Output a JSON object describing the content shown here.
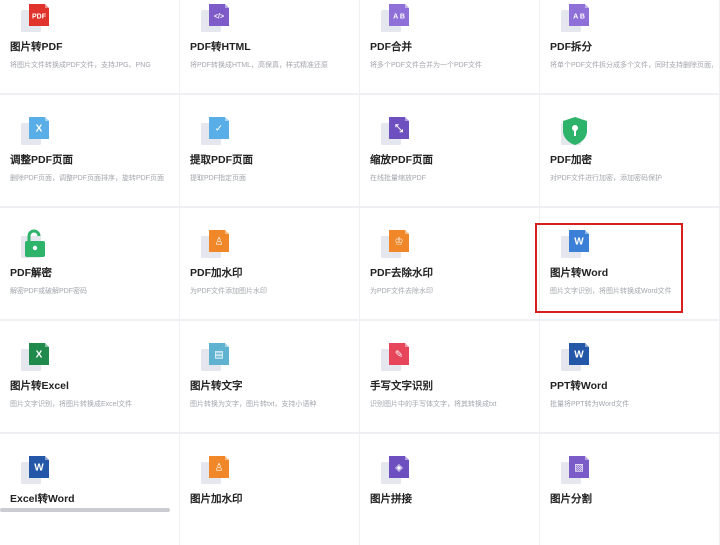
{
  "tools": [
    {
      "title": "图片转PDF",
      "desc": "将图片文件转换成PDF文件，支持JPG、PNG",
      "icon": "image-to-pdf-icon",
      "tag": "PDF",
      "color": "#e0332b"
    },
    {
      "title": "PDF转HTML",
      "desc": "将PDF转换成HTML，高保真，样式精准还原",
      "icon": "pdf-to-html-icon",
      "tag": "</>",
      "color": "#7d5cc9"
    },
    {
      "title": "PDF合并",
      "desc": "将多个PDF文件合并为一个PDF文件",
      "icon": "pdf-merge-icon",
      "tag": "A B",
      "color": "#8e70d8"
    },
    {
      "title": "PDF拆分",
      "desc": "将单个PDF文件拆分成多个文件，同时支持删除页面，对页面进行排序",
      "icon": "pdf-split-icon",
      "tag": "A B",
      "color": "#8e70d8"
    },
    {
      "title": "调整PDF页面",
      "desc": "删除PDF页面，调整PDF页面排序，旋转PDF页面",
      "icon": "adjust-pdf-pages-icon",
      "tag": "X",
      "color": "#5aaee8"
    },
    {
      "title": "提取PDF页面",
      "desc": "提取PDF指定页面",
      "icon": "extract-pdf-pages-icon",
      "tag": "✓",
      "color": "#5aaee8"
    },
    {
      "title": "缩放PDF页面",
      "desc": "在线批量缩放PDF",
      "icon": "scale-pdf-pages-icon",
      "tag": "⤡",
      "color": "#6e4fc0"
    },
    {
      "title": "PDF加密",
      "desc": "对PDF文件进行加密，添加密码保护",
      "icon": "pdf-encrypt-icon",
      "tag": "",
      "color": "#2eb36b"
    },
    {
      "title": "PDF解密",
      "desc": "解密PDF或破解PDF密码",
      "icon": "pdf-decrypt-icon",
      "tag": "",
      "color": "#2eb36b"
    },
    {
      "title": "PDF加水印",
      "desc": "为PDF文件添加图片水印",
      "icon": "pdf-add-watermark-icon",
      "tag": "♙",
      "color": "#f0882a"
    },
    {
      "title": "PDF去除水印",
      "desc": "为PDF文件去除水印",
      "icon": "pdf-remove-watermark-icon",
      "tag": "♔",
      "color": "#f0882a"
    },
    {
      "title": "图片转Word",
      "desc": "图片文字识别，将图片转换成Word文件",
      "icon": "image-to-word-icon",
      "tag": "W",
      "color": "#3c7fd6"
    },
    {
      "title": "图片转Excel",
      "desc": "图片文字识别，将图片转换成Excel文件",
      "icon": "image-to-excel-icon",
      "tag": "X",
      "color": "#1f8a4c"
    },
    {
      "title": "图片转文字",
      "desc": "图片转换为文字，图片转txt，支持小语种",
      "icon": "image-to-text-icon",
      "tag": "▤",
      "color": "#5fb3d1"
    },
    {
      "title": "手写文字识别",
      "desc": "识别图片中的手写体文字，将其转换成txt",
      "icon": "handwriting-recognition-icon",
      "tag": "✎",
      "color": "#e6455a"
    },
    {
      "title": "PPT转Word",
      "desc": "批量将PPT转为Word文件",
      "icon": "ppt-to-word-icon",
      "tag": "W",
      "color": "#2457a8"
    },
    {
      "title": "Excel转Word",
      "desc": "",
      "icon": "excel-to-word-icon",
      "tag": "W",
      "color": "#2457a8"
    },
    {
      "title": "图片加水印",
      "desc": "",
      "icon": "image-add-watermark-icon",
      "tag": "♙",
      "color": "#f0882a"
    },
    {
      "title": "图片拼接",
      "desc": "",
      "icon": "image-stitch-icon",
      "tag": "◈",
      "color": "#6e4fc0"
    },
    {
      "title": "图片分割",
      "desc": "",
      "icon": "image-split-icon",
      "tag": "▧",
      "color": "#7a5bc7"
    }
  ],
  "highlighted_index": 11
}
